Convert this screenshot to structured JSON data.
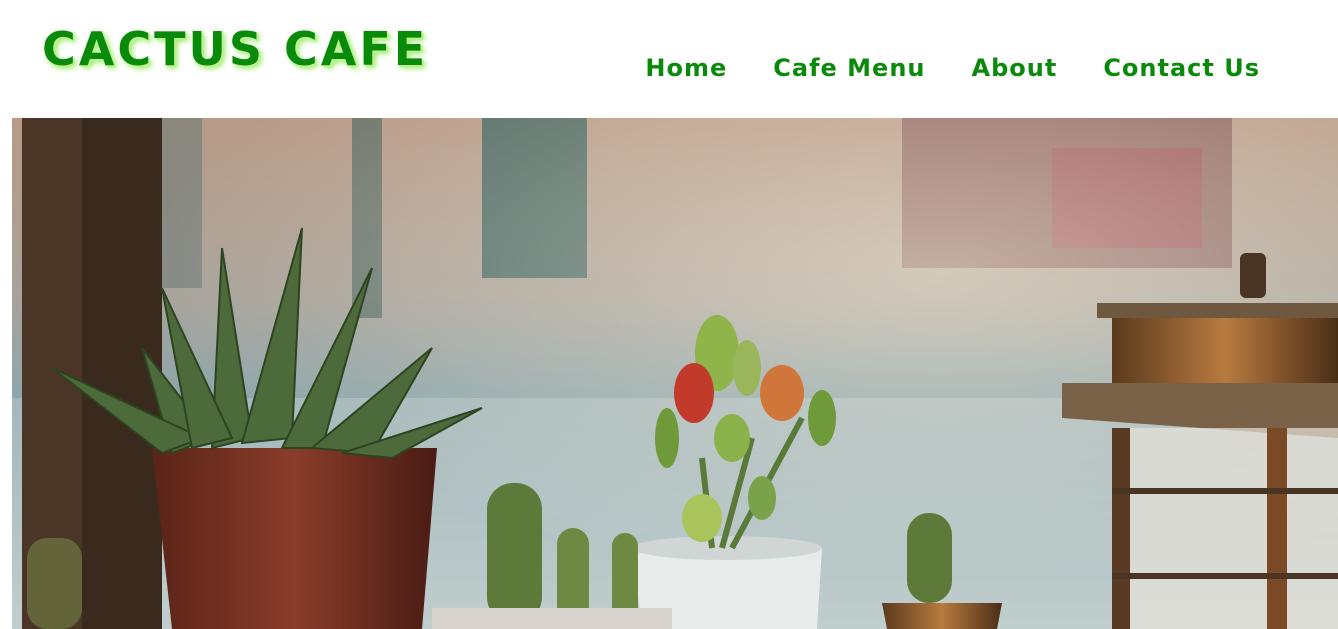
{
  "header": {
    "logo": "CACTUS CAFE",
    "nav": [
      "Home",
      "Cafe Menu",
      "About",
      "Contact Us"
    ]
  },
  "hero": {
    "icon": "cactus-plants-photo"
  },
  "colors": {
    "accent": "#0a8a0a",
    "accent_glow": "#b9f58a"
  }
}
